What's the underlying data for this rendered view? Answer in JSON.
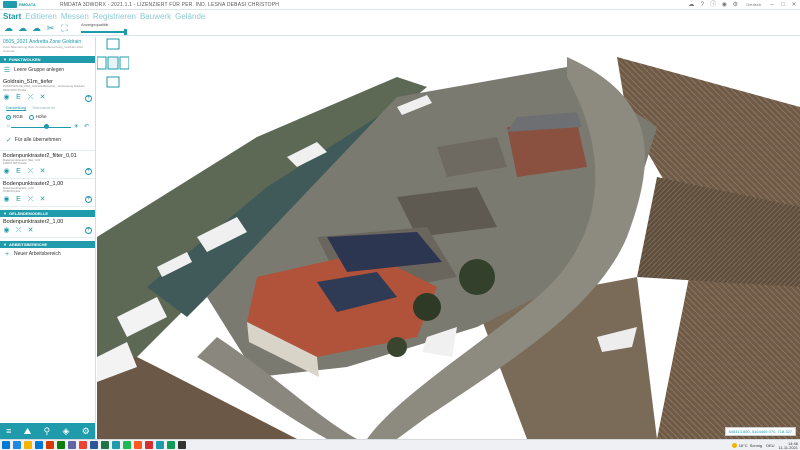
{
  "app": {
    "logo_text": "RMDATA",
    "title": "RMDATA 3DWORX - 2021.1.1 - LIZENZIERT FÜR PER. IND. LESNA DEBASI CHRISTOPH",
    "language": "Deutsch"
  },
  "menu": {
    "items": [
      "Start",
      "Editieren",
      "Messen",
      "Registrieren",
      "Bauwerk",
      "Gelände"
    ],
    "active": "Start"
  },
  "toolbar": {
    "quality_label": "Anzeigequalität",
    "quality_value": 0.98
  },
  "panel": {
    "project_title": "0505_2021 Andretta Zone Goldrain",
    "project_subtitle": "Zone Bilanzierung 2021 Andretta Bewerbung_Goldrain 2021 Andretta ...",
    "sections": {
      "point_clouds": "PUNKTWOLKEN",
      "terrain_models": "GELÄNDEMODELLE",
      "workspaces": "ARBEITSBEREICHE"
    },
    "empty_group_label": "Leere Gruppe anlegen",
    "layers": [
      {
        "name": "Goldrain_51m_tiefer",
        "meta": [
          "PUNKTWOLKE_2021_Andretta Bewerber_ Vermessung Goldrain",
          "660170210 Punkte"
        ]
      },
      {
        "name": "Bodenpunktraster2_filter_0,01",
        "meta": [
          "Bodenpunktraster2_filter_0,01",
          "111876 095 Punkte"
        ]
      },
      {
        "name": "Bodenpunktraster2_1,00",
        "meta": [
          "Bodenpunktraster2_1,00",
          "87300 Punkte"
        ]
      }
    ],
    "terrain_layer": "Bodenpunktraster2_1,00",
    "display_tabs": [
      "Darstellung",
      "Standardinfo"
    ],
    "color_modes": [
      "RGB",
      "Höhe"
    ],
    "color_mode_selected": "RGB",
    "opacity_value": 0.55,
    "apply_all_label": "Für alle übernehmen",
    "new_workspace_label": "Neuer Arbeitsbereich"
  },
  "viewport": {
    "coords": "645413.850, 5164469.070, 718.327"
  },
  "taskbar": {
    "temperature": "16°C",
    "weather": "Sonnig",
    "time": "14:46",
    "date": "11.11.2021",
    "lang": "DEU",
    "app_colors": [
      "#1e88e5",
      "#f4b400",
      "#0078d7",
      "#d83b01",
      "#107c10",
      "#6264a7",
      "#ea4335",
      "#2b579a",
      "#217346",
      "#1f9bab",
      "#1db954",
      "#ff5722",
      "#d32f2f",
      "#1f9bab",
      "#0f9d58",
      "#333333"
    ]
  }
}
